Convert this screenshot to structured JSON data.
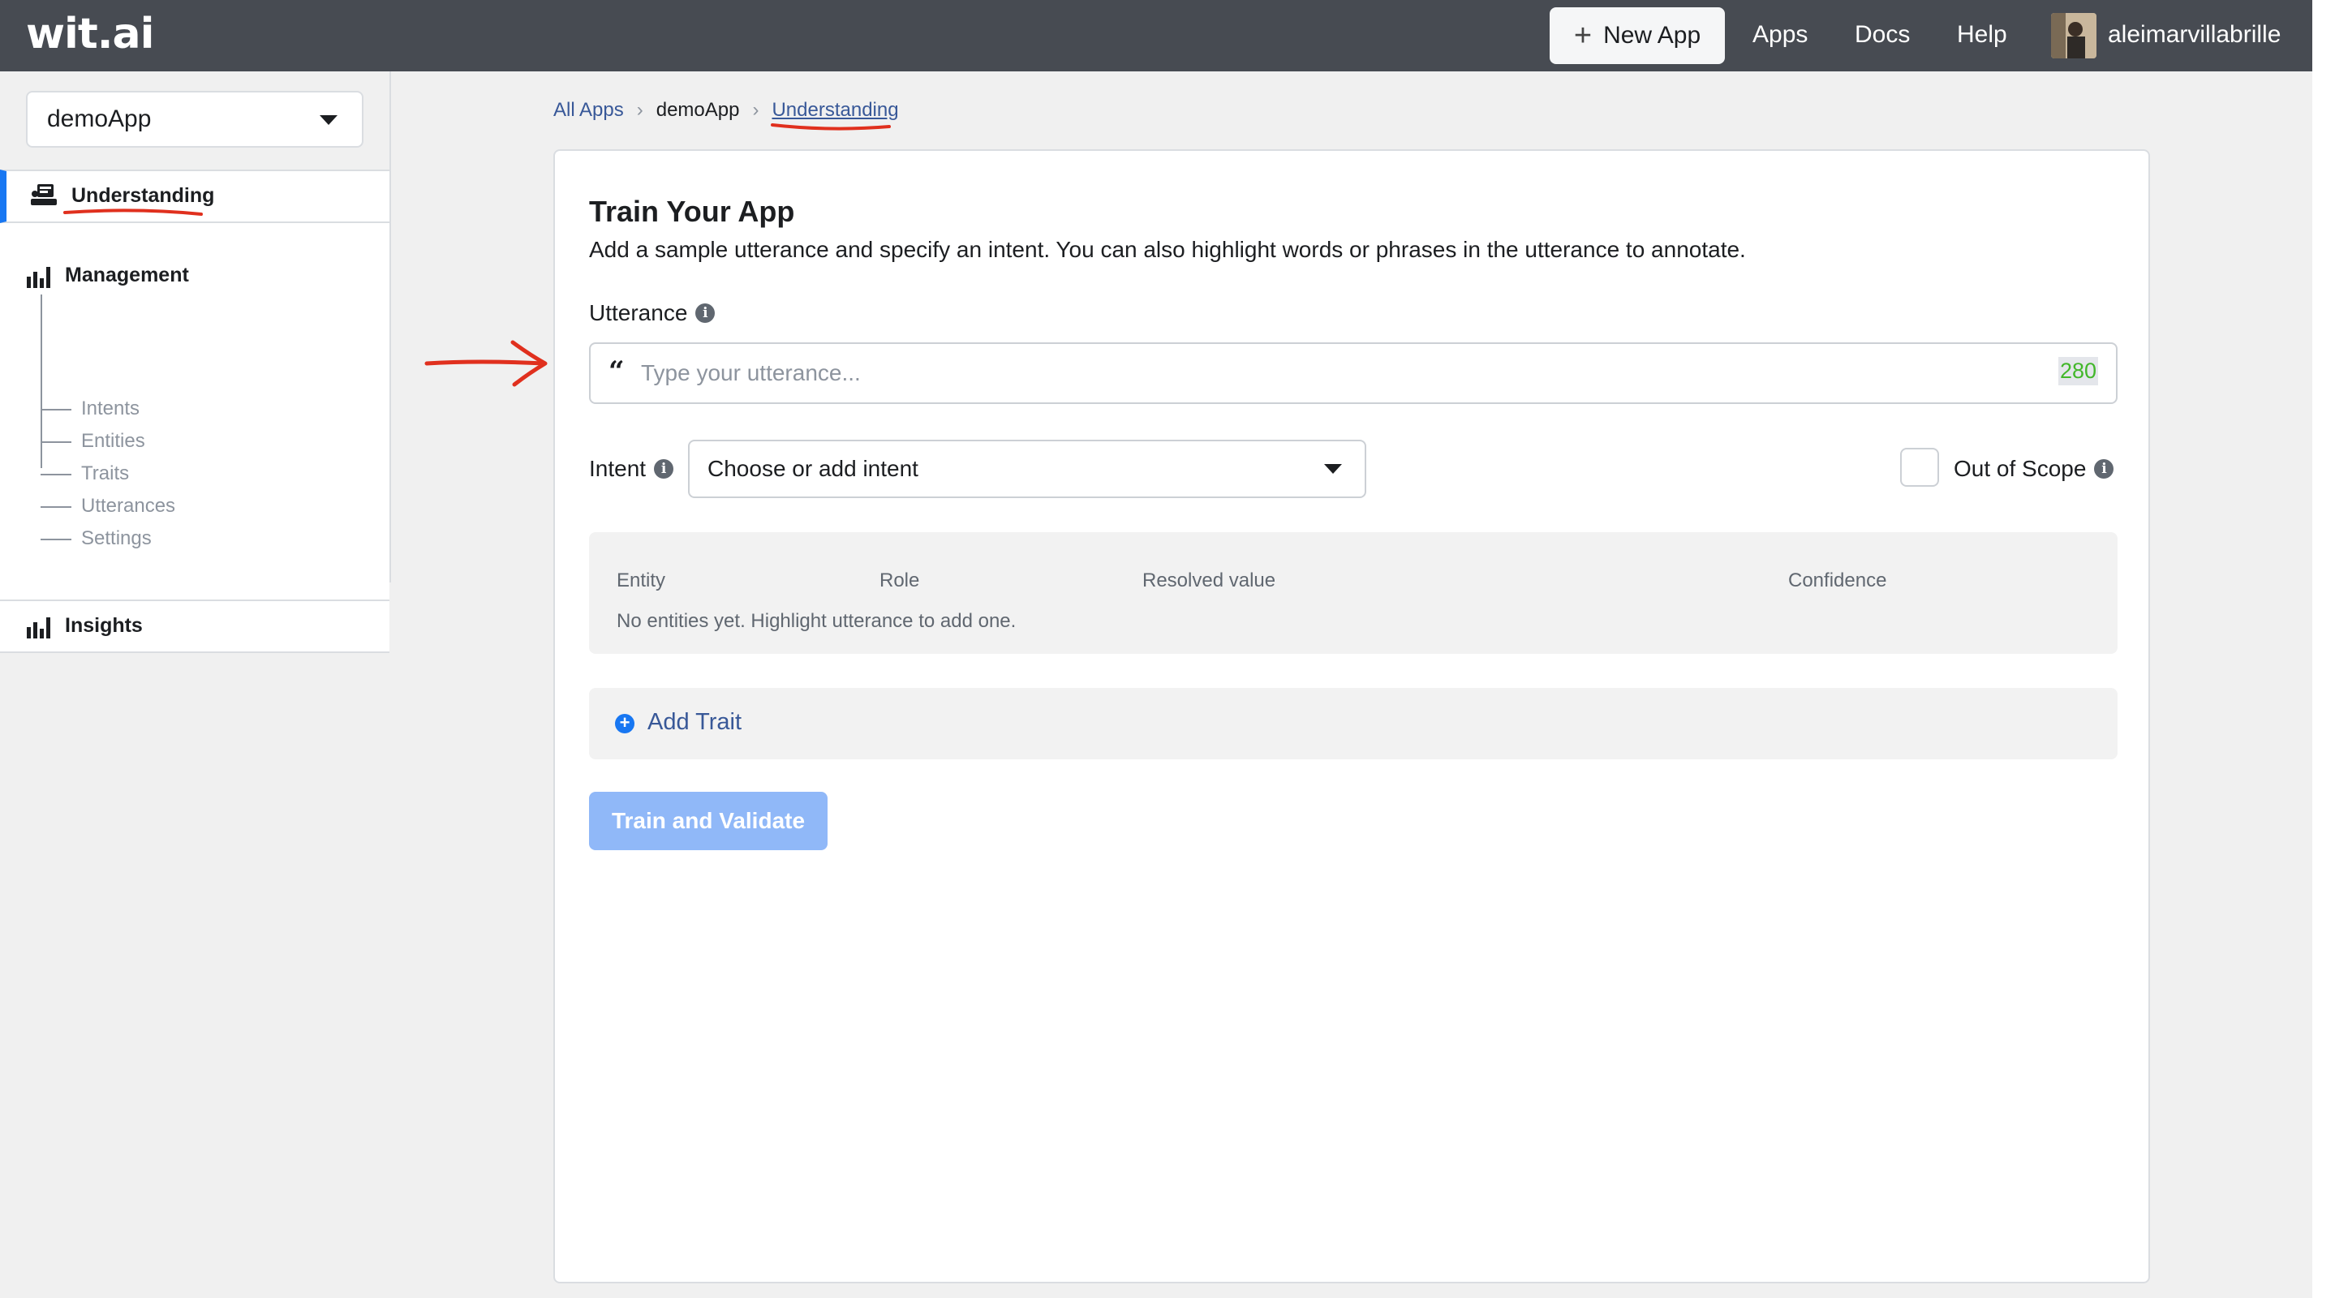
{
  "topbar": {
    "logo": "wit.ai",
    "new_app_label": "New App",
    "nav": [
      "Apps",
      "Docs",
      "Help"
    ],
    "username": "aleimarvillabrille"
  },
  "sidebar": {
    "app_select_value": "demoApp",
    "understanding_label": "Understanding",
    "management_label": "Management",
    "management_items": [
      "Intents",
      "Entities",
      "Traits",
      "Utterances",
      "Settings"
    ],
    "insights_label": "Insights"
  },
  "breadcrumb": {
    "all_apps": "All Apps",
    "app": "demoApp",
    "current": "Understanding"
  },
  "train": {
    "title": "Train Your App",
    "subtitle": "Add a sample utterance and specify an intent. You can also highlight words or phrases in the utterance to annotate.",
    "utterance_label": "Utterance",
    "utterance_placeholder": "Type your utterance...",
    "char_count": "280",
    "intent_label": "Intent",
    "intent_placeholder": "Choose or add intent",
    "out_of_scope_label": "Out of Scope",
    "entity_headers": [
      "Entity",
      "Role",
      "Resolved value",
      "Confidence"
    ],
    "entity_empty": "No entities yet. Highlight utterance to add one.",
    "add_trait_label": "Add Trait",
    "train_button": "Train and Validate"
  },
  "colors": {
    "topbar": "#474b52",
    "accent": "#1877f2",
    "link": "#385898",
    "annotation": "#e0301e",
    "count_ok": "#42b72a",
    "train_disabled": "#90b8f8"
  }
}
